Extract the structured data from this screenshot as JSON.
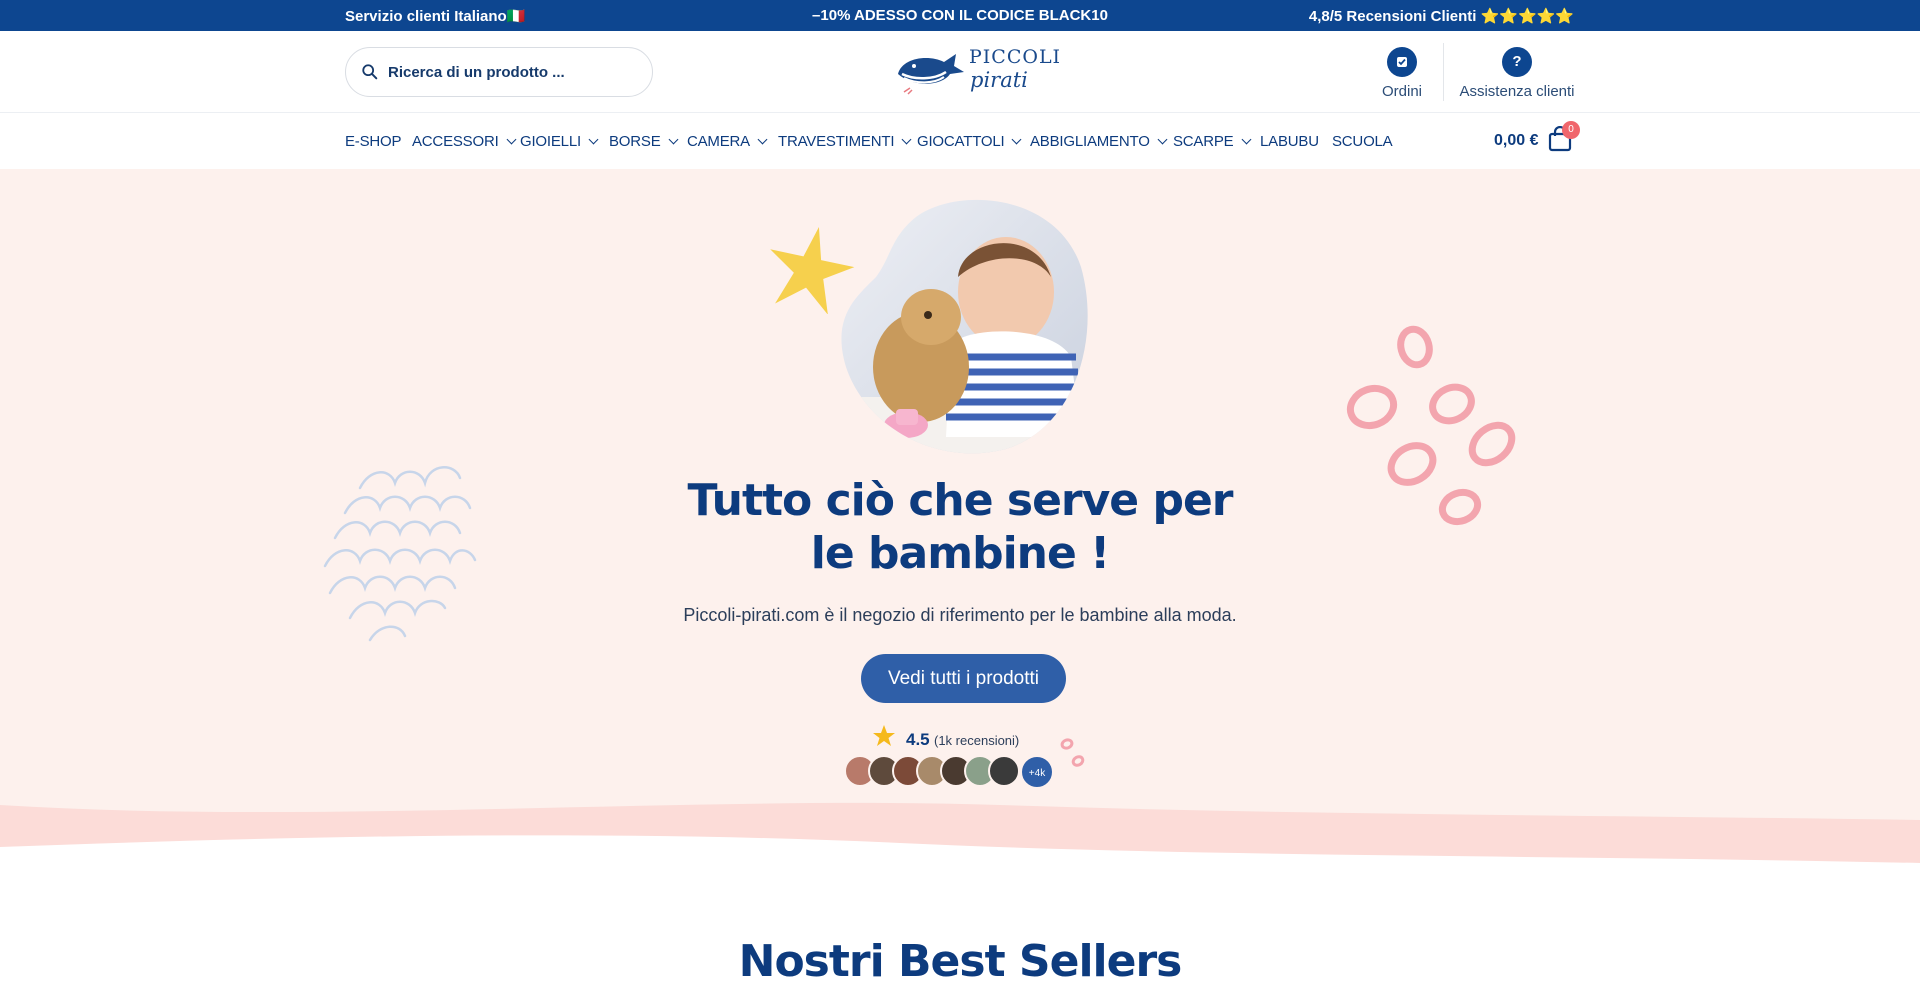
{
  "topbar": {
    "left": "Servizio clienti Italiano🇮🇹",
    "center": "–10% ADESSO CON IL CODICE BLACK10",
    "right": "4,8/5 Recensioni Clienti ⭐⭐⭐⭐⭐"
  },
  "header": {
    "search_placeholder": "Ricerca di un prodotto ...",
    "logo_line1": "PICCOLI",
    "logo_line2": "pirati",
    "orders_label": "Ordini",
    "help_label": "Assistenza clienti",
    "help_icon_glyph": "?"
  },
  "nav": {
    "items": [
      {
        "label": "E-SHOP",
        "dropdown": false
      },
      {
        "label": "ACCESSORI",
        "dropdown": true
      },
      {
        "label": "GIOIELLI",
        "dropdown": true
      },
      {
        "label": "BORSE",
        "dropdown": true
      },
      {
        "label": "CAMERA",
        "dropdown": true
      },
      {
        "label": "TRAVESTIMENTI",
        "dropdown": true
      },
      {
        "label": "GIOCATTOLI",
        "dropdown": true
      },
      {
        "label": "ABBIGLIAMENTO",
        "dropdown": true
      },
      {
        "label": "SCARPE",
        "dropdown": true
      },
      {
        "label": "LABUBU",
        "dropdown": false
      },
      {
        "label": "SCUOLA",
        "dropdown": false
      }
    ],
    "cart_total": "0,00 €",
    "cart_count": "0"
  },
  "hero": {
    "title_line1": "Tutto ciò che serve per",
    "title_line2": "le bambine !",
    "subtitle": "Piccoli-pirati.com è il negozio di riferimento per le bambine alla moda.",
    "cta_label": "Vedi tutti i prodotti",
    "rating_value": "4.5",
    "rating_count": "(1k recensioni)",
    "avatars_more": "+4k"
  },
  "best_sellers": {
    "title": "Nostri Best Sellers"
  },
  "colors": {
    "brand_blue": "#0d4690",
    "button_blue": "#2f5fa8",
    "hero_bg": "#fdf1ed",
    "wave_pink": "#fcdcd8",
    "badge_red": "#f0666c",
    "star_yellow": "#f6d04d"
  }
}
